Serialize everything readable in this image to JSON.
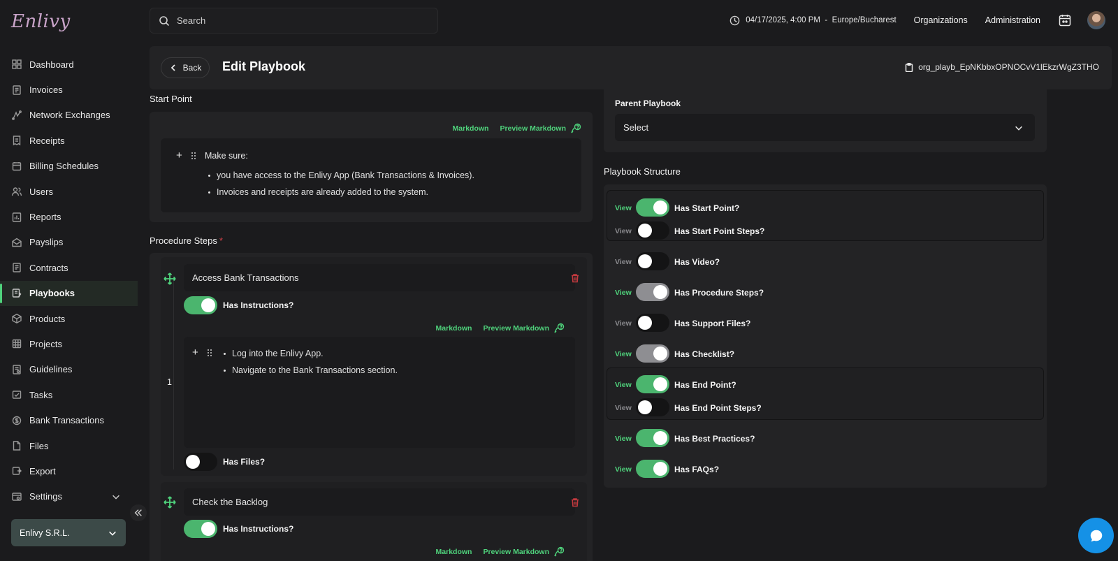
{
  "app": {
    "logo": "Enlivy"
  },
  "sidebar": {
    "items": [
      {
        "label": "Dashboard",
        "icon": "dashboard-icon"
      },
      {
        "label": "Invoices",
        "icon": "invoice-icon"
      },
      {
        "label": "Network Exchanges",
        "icon": "network-icon"
      },
      {
        "label": "Receipts",
        "icon": "receipt-icon"
      },
      {
        "label": "Billing Schedules",
        "icon": "billing-icon"
      },
      {
        "label": "Users",
        "icon": "users-icon"
      },
      {
        "label": "Reports",
        "icon": "reports-icon"
      },
      {
        "label": "Payslips",
        "icon": "payslip-icon"
      },
      {
        "label": "Contracts",
        "icon": "contract-icon"
      },
      {
        "label": "Playbooks",
        "icon": "playbook-icon",
        "active": true
      },
      {
        "label": "Products",
        "icon": "products-icon"
      },
      {
        "label": "Projects",
        "icon": "projects-icon"
      },
      {
        "label": "Guidelines",
        "icon": "guidelines-icon"
      },
      {
        "label": "Tasks",
        "icon": "tasks-icon"
      },
      {
        "label": "Bank Transactions",
        "icon": "bank-icon"
      },
      {
        "label": "Files",
        "icon": "file-icon"
      },
      {
        "label": "Export",
        "icon": "export-icon"
      },
      {
        "label": "Settings",
        "icon": "settings-icon"
      }
    ],
    "organization": "Enlivy S.R.L."
  },
  "topbar": {
    "search_placeholder": "Search",
    "datetime": "04/17/2025, 4:00 PM  -  Europe/Bucharest",
    "links": [
      "Organizations",
      "Administration"
    ]
  },
  "header": {
    "back_label": "Back",
    "title": "Edit Playbook",
    "org_id": "org_playb_EpNKbbxOPNOCvV1lEkzrWgZ3THO"
  },
  "start_point": {
    "label": "Start Point",
    "markdown": "Markdown",
    "preview_markdown": "Preview Markdown",
    "intro": "Make sure:",
    "bullets": [
      "you have access to the Enlivy App (Bank Transactions & Invoices).",
      "Invoices and receipts are already added to the system."
    ]
  },
  "procedure": {
    "label": "Procedure Steps",
    "required_mark": "*",
    "steps": [
      {
        "number": "1",
        "title": "Access Bank Transactions",
        "has_instructions_label": "Has Instructions?",
        "has_instructions": true,
        "markdown": "Markdown",
        "preview_markdown": "Preview Markdown",
        "bullets": [
          "Log into the Enlivy App.",
          "Navigate to the Bank Transactions section."
        ],
        "has_files_label": "Has Files?",
        "has_files": false
      },
      {
        "title": "Check the Backlog",
        "has_instructions_label": "Has Instructions?",
        "has_instructions": true,
        "markdown": "Markdown",
        "preview_markdown": "Preview Markdown"
      }
    ]
  },
  "parent_playbook": {
    "label": "Parent Playbook",
    "value": "Select"
  },
  "structure": {
    "label": "Playbook Structure",
    "view_label": "View",
    "items": [
      {
        "label": "Has Start Point?",
        "state": "on",
        "view": "green"
      },
      {
        "label": "Has Start Point Steps?",
        "state": "off",
        "view": "dim"
      },
      {
        "label": "Has Video?",
        "state": "off",
        "view": "dim"
      },
      {
        "label": "Has Procedure Steps?",
        "state": "gray",
        "view": "green"
      },
      {
        "label": "Has Support Files?",
        "state": "off",
        "view": "dim"
      },
      {
        "label": "Has Checklist?",
        "state": "gray",
        "view": "green"
      },
      {
        "label": "Has End Point?",
        "state": "on",
        "view": "green"
      },
      {
        "label": "Has End Point Steps?",
        "state": "off",
        "view": "dim"
      },
      {
        "label": "Has Best Practices?",
        "state": "on",
        "view": "green"
      },
      {
        "label": "Has FAQs?",
        "state": "on",
        "view": "green"
      }
    ]
  },
  "colors": {
    "accent": "#4fd37c",
    "toggle_on": "#4bb56e",
    "danger": "#c43a3f",
    "chat": "#1591e6"
  }
}
